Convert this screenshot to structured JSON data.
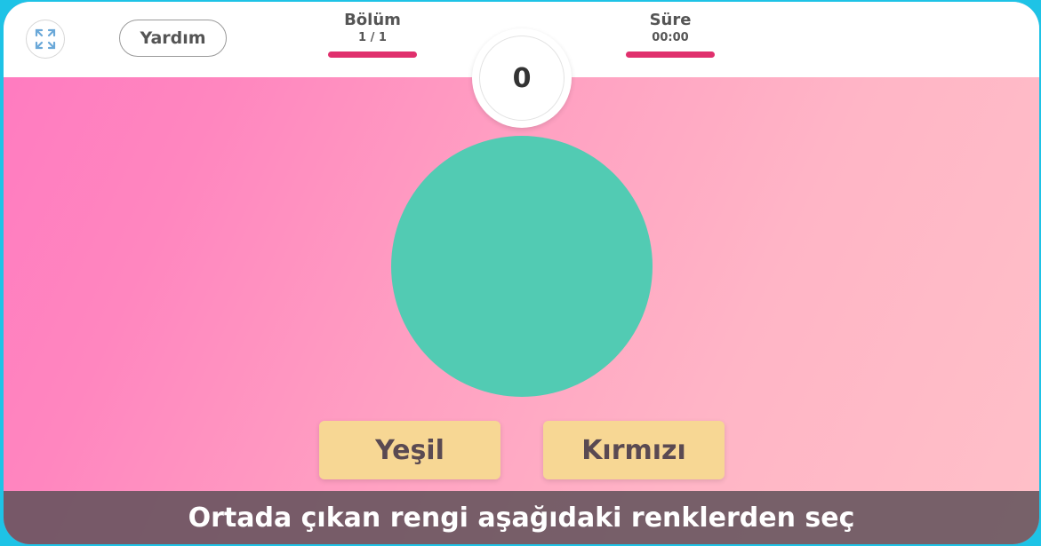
{
  "header": {
    "help_label": "Yardım",
    "level": {
      "label": "Bölüm",
      "value": "1 / 1",
      "progress": 1.0
    },
    "time": {
      "label": "Süre",
      "value": "00:00",
      "progress": 1.0
    },
    "score": "0",
    "fullscreen_icon": "expand-icon"
  },
  "game": {
    "circle_color": "#52cbb3",
    "options": [
      {
        "label": "Yeşil"
      },
      {
        "label": "Kırmızı"
      }
    ]
  },
  "instruction": "Ortada çıkan rengi aşağıdaki renklerden seç",
  "colors": {
    "accent_bar": "#e0306d",
    "button": "#f7d794",
    "frame_border": "#1ec3e6"
  }
}
